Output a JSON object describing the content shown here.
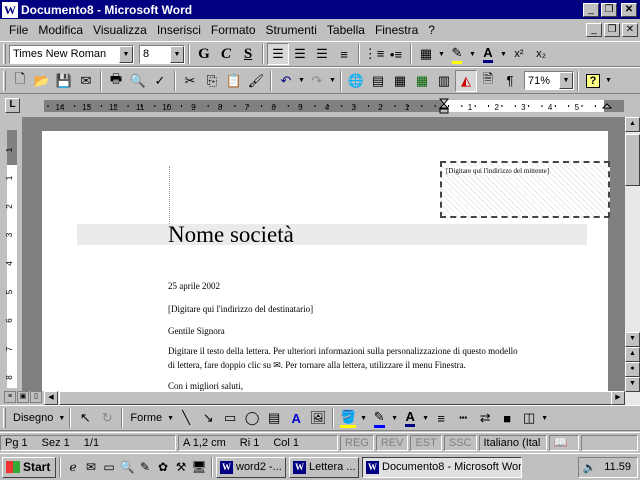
{
  "window": {
    "title": "Documento8 - Microsoft Word",
    "minimize": "_",
    "restore": "❐",
    "close": "✕"
  },
  "menu": [
    "File",
    "Modifica",
    "Visualizza",
    "Inserisci",
    "Formato",
    "Strumenti",
    "Tabella",
    "Finestra",
    "?"
  ],
  "formatting": {
    "font": "Times New Roman",
    "size": "8",
    "bold": "G",
    "italic": "C",
    "underline": "S"
  },
  "standard": {
    "zoom": "71%",
    "help": "?"
  },
  "ruler": {
    "left_ticks": [
      "14",
      "13",
      "12",
      "11",
      "10",
      "9",
      "8",
      "7",
      "6",
      "5",
      "4",
      "3",
      "2",
      "1"
    ],
    "right_ticks": [
      "1",
      "2",
      "3",
      "4",
      "5"
    ],
    "vertical_ticks": [
      "1",
      "1",
      "2",
      "3",
      "4",
      "5",
      "6",
      "7",
      "8"
    ]
  },
  "document": {
    "address_box": "[Digitare qui l'indirizzo del mittente]",
    "company": "Nome società",
    "date": "25 aprile 2002",
    "recipient": "[Digitare qui l'indirizzo del destinatario]",
    "greeting": "Gentile Signora",
    "body_1": "Digitare il testo della lettera. Per ulteriori informazioni sulla personalizzazione di questo modello",
    "body_2": "di lettera, fare doppio clic su ✉. Per tornare alla lettera, utilizzare il menu Finestra.",
    "closing": "Con i migliori saluti,"
  },
  "drawing": {
    "draw_label": "Disegno",
    "shapes_label": "Forme"
  },
  "status": {
    "page": "Pg 1",
    "section": "Sez 1",
    "pages": "1/1",
    "position": "A 1,2 cm",
    "line": "Ri 1",
    "column": "Col 1",
    "rec": "REG",
    "rev": "REV",
    "ext": "EST",
    "ovr": "SSC",
    "language": "Italiano (Ital"
  },
  "taskbar": {
    "start": "Start",
    "tasks": [
      "word2 -...",
      "Lettera ...",
      "Documento8 - Microsoft Word"
    ],
    "clock": "11.59"
  },
  "colors": {
    "title_bg": "#000080",
    "face": "#c0c0c0",
    "workspace": "#808080"
  }
}
